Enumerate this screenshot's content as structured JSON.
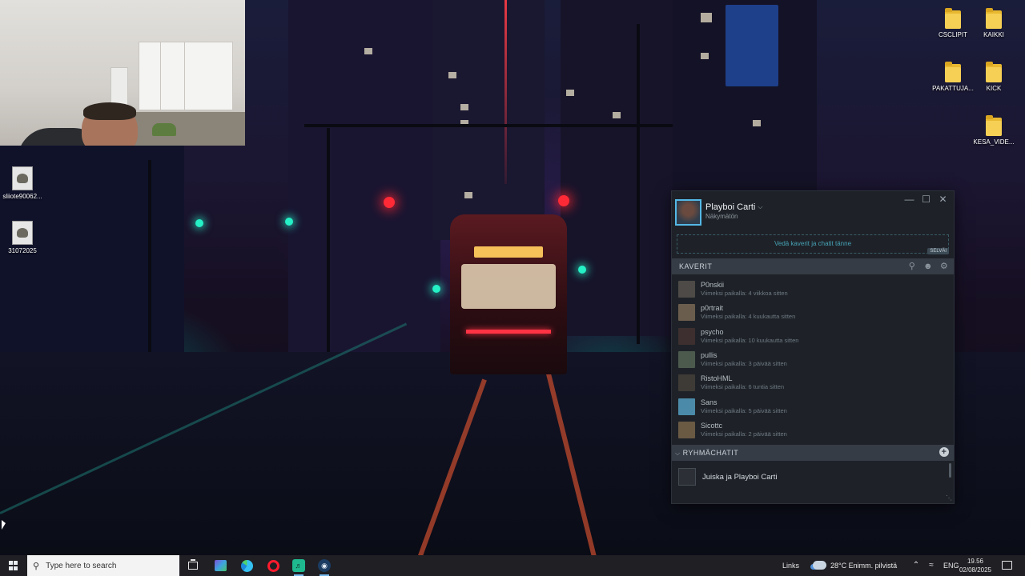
{
  "desktop": {
    "left_icons": [
      {
        "label": "sliiote90062...",
        "icon": "image-file-icon"
      },
      {
        "label": "31072025",
        "icon": "image-file-icon"
      }
    ],
    "right_icons": [
      {
        "label": "CSCLIPIT",
        "icon": "folder-icon"
      },
      {
        "label": "KAIKKI",
        "icon": "folder-icon"
      },
      {
        "label": "PAKATTUJA...",
        "icon": "folder-icon"
      },
      {
        "label": "KICK",
        "icon": "folder-icon"
      },
      {
        "label": "KESA_VIDE...",
        "icon": "folder-icon"
      }
    ]
  },
  "steam": {
    "window_controls": {
      "minimize": "—",
      "maximize": "☐",
      "close": "✕"
    },
    "profile": {
      "name": "Playboi Carti",
      "status": "Näkymätön"
    },
    "invite_text": "Vedä kaverit ja chatit tänne",
    "dismiss_label": "SELVÄI",
    "friends_header": "KAVERIT",
    "friends": [
      {
        "name": "P0nskii",
        "seen": "Viimeksi paikalla: 4 viikkoa sitten"
      },
      {
        "name": "p0rtrait",
        "seen": "Viimeksi paikalla: 4 kuukautta sitten"
      },
      {
        "name": "psycho",
        "seen": "Viimeksi paikalla: 10 kuukautta sitten"
      },
      {
        "name": "pullis",
        "seen": "Viimeksi paikalla: 3 päivää sitten"
      },
      {
        "name": "RistoHML",
        "seen": "Viimeksi paikalla: 6 tuntia sitten"
      },
      {
        "name": "Sans",
        "seen": "Viimeksi paikalla: 5 päivää sitten"
      },
      {
        "name": "Sicottc",
        "seen": "Viimeksi paikalla: 2 päivää sitten"
      }
    ],
    "groups_header": "RYHMÄCHATIT",
    "groups": [
      {
        "name": "Juiska ja Playboi Carti"
      }
    ],
    "colors": {
      "accent": "#54b8e6",
      "invite_text": "#47a3b7"
    }
  },
  "taskbar": {
    "search_placeholder": "Type here to search",
    "apps": [
      "task-view",
      "onenote",
      "edge",
      "opera",
      "spotify",
      "steam"
    ],
    "links_label": "Links",
    "weather": "28°C  Enimm. pilvistä",
    "language": "ENG",
    "time": "19.56",
    "date": "02/08/2025"
  }
}
